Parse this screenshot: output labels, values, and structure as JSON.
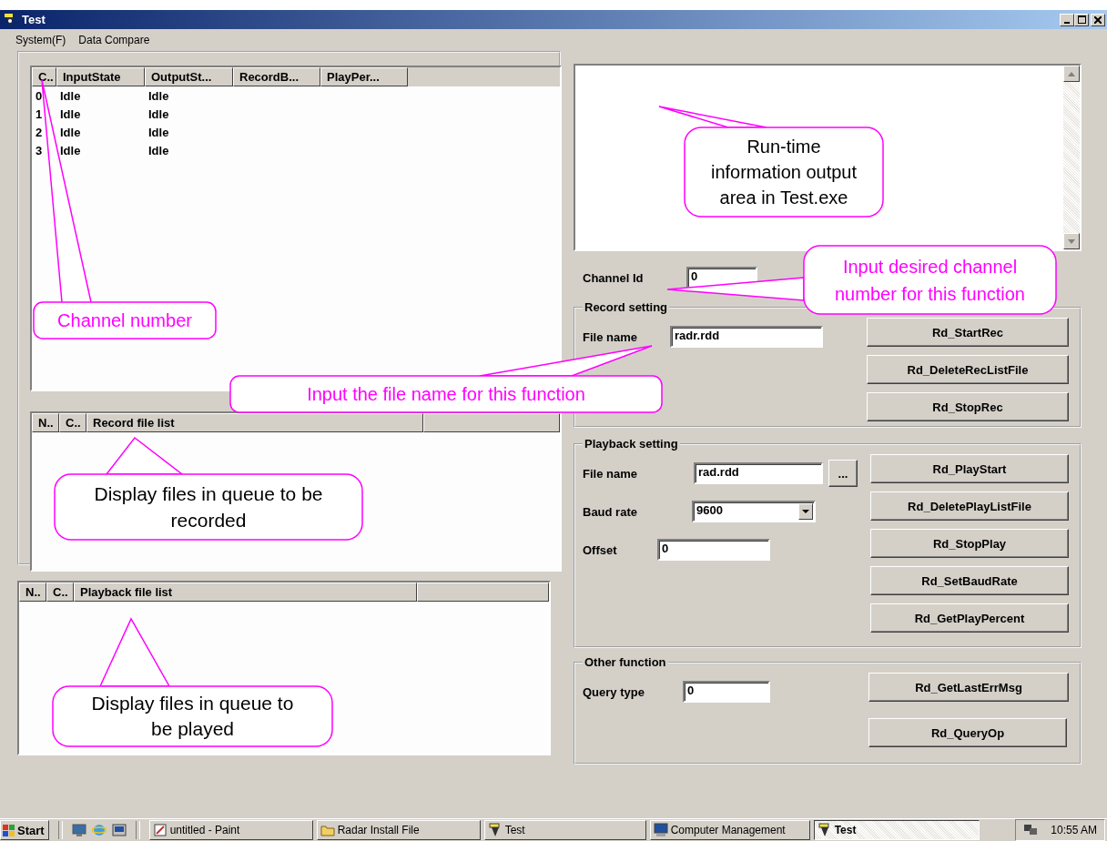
{
  "window": {
    "title": "Test"
  },
  "menu": [
    "System(F)",
    "Data Compare"
  ],
  "channel_table": {
    "columns": [
      "C..",
      "InputState",
      "OutputSt...",
      "RecordB...",
      "PlayPer..."
    ],
    "rows": [
      [
        "0",
        "Idle",
        "Idle"
      ],
      [
        "1",
        "Idle",
        "Idle"
      ],
      [
        "2",
        "Idle",
        "Idle"
      ],
      [
        "3",
        "Idle",
        "Idle"
      ]
    ]
  },
  "record_list": {
    "columns": [
      "N..",
      "C..",
      "Record file list"
    ]
  },
  "playback_list": {
    "columns": [
      "N..",
      "C..",
      "Playback file list"
    ]
  },
  "channel_id": {
    "label": "Channel Id",
    "value": "0"
  },
  "record_setting": {
    "title": "Record setting",
    "fields": [
      {
        "kind": "text",
        "label": "File name",
        "value": "radr.rdd"
      }
    ],
    "buttons": [
      "Rd_StartRec",
      "Rd_DeleteRecListFile",
      "Rd_StopRec"
    ]
  },
  "playback_setting": {
    "title": "Playback setting",
    "fields": [
      {
        "kind": "file",
        "label": "File name",
        "value": "rad.rdd",
        "browse": "..."
      },
      {
        "kind": "combo",
        "label": "Baud rate",
        "value": "9600"
      },
      {
        "kind": "text",
        "label": "Offset",
        "value": "0"
      }
    ],
    "buttons": [
      "Rd_PlayStart",
      "Rd_DeletePlayListFile",
      "Rd_StopPlay",
      "Rd_SetBaudRate",
      "Rd_GetPlayPercent"
    ]
  },
  "other_function": {
    "title": "Other function",
    "fields": [
      {
        "kind": "text",
        "label": "Query type",
        "value": "0"
      }
    ],
    "buttons": [
      "Rd_GetLastErrMsg",
      "Rd_QueryOp"
    ]
  },
  "callouts": [
    {
      "text": "Channel number"
    },
    {
      "text": "Run-time information output area in Test.exe"
    },
    {
      "text": "Input desired channel number for this function"
    },
    {
      "text": "Input the file name for this function"
    },
    {
      "text": "Display files in queue to be recorded"
    },
    {
      "text": "Display files in queue to be played"
    }
  ],
  "taskbar": {
    "start": "Start",
    "items": [
      {
        "label": "untitled - Paint",
        "kind": "paint",
        "selected": false
      },
      {
        "label": "Radar Install File",
        "kind": "folder",
        "selected": false
      },
      {
        "label": "Test",
        "kind": "app",
        "selected": false
      },
      {
        "label": "Computer Management",
        "kind": "computer",
        "selected": false
      },
      {
        "label": "Test",
        "kind": "app",
        "selected": true
      }
    ],
    "clock": "10:55 AM"
  }
}
